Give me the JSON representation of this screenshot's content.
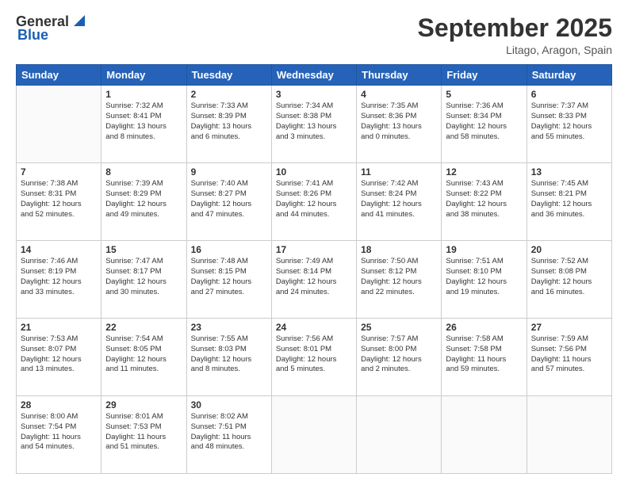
{
  "header": {
    "logo_general": "General",
    "logo_blue": "Blue",
    "month_title": "September 2025",
    "location": "Litago, Aragon, Spain"
  },
  "weekdays": [
    "Sunday",
    "Monday",
    "Tuesday",
    "Wednesday",
    "Thursday",
    "Friday",
    "Saturday"
  ],
  "weeks": [
    [
      {
        "day": "",
        "info": ""
      },
      {
        "day": "1",
        "info": "Sunrise: 7:32 AM\nSunset: 8:41 PM\nDaylight: 13 hours\nand 8 minutes."
      },
      {
        "day": "2",
        "info": "Sunrise: 7:33 AM\nSunset: 8:39 PM\nDaylight: 13 hours\nand 6 minutes."
      },
      {
        "day": "3",
        "info": "Sunrise: 7:34 AM\nSunset: 8:38 PM\nDaylight: 13 hours\nand 3 minutes."
      },
      {
        "day": "4",
        "info": "Sunrise: 7:35 AM\nSunset: 8:36 PM\nDaylight: 13 hours\nand 0 minutes."
      },
      {
        "day": "5",
        "info": "Sunrise: 7:36 AM\nSunset: 8:34 PM\nDaylight: 12 hours\nand 58 minutes."
      },
      {
        "day": "6",
        "info": "Sunrise: 7:37 AM\nSunset: 8:33 PM\nDaylight: 12 hours\nand 55 minutes."
      }
    ],
    [
      {
        "day": "7",
        "info": "Sunrise: 7:38 AM\nSunset: 8:31 PM\nDaylight: 12 hours\nand 52 minutes."
      },
      {
        "day": "8",
        "info": "Sunrise: 7:39 AM\nSunset: 8:29 PM\nDaylight: 12 hours\nand 49 minutes."
      },
      {
        "day": "9",
        "info": "Sunrise: 7:40 AM\nSunset: 8:27 PM\nDaylight: 12 hours\nand 47 minutes."
      },
      {
        "day": "10",
        "info": "Sunrise: 7:41 AM\nSunset: 8:26 PM\nDaylight: 12 hours\nand 44 minutes."
      },
      {
        "day": "11",
        "info": "Sunrise: 7:42 AM\nSunset: 8:24 PM\nDaylight: 12 hours\nand 41 minutes."
      },
      {
        "day": "12",
        "info": "Sunrise: 7:43 AM\nSunset: 8:22 PM\nDaylight: 12 hours\nand 38 minutes."
      },
      {
        "day": "13",
        "info": "Sunrise: 7:45 AM\nSunset: 8:21 PM\nDaylight: 12 hours\nand 36 minutes."
      }
    ],
    [
      {
        "day": "14",
        "info": "Sunrise: 7:46 AM\nSunset: 8:19 PM\nDaylight: 12 hours\nand 33 minutes."
      },
      {
        "day": "15",
        "info": "Sunrise: 7:47 AM\nSunset: 8:17 PM\nDaylight: 12 hours\nand 30 minutes."
      },
      {
        "day": "16",
        "info": "Sunrise: 7:48 AM\nSunset: 8:15 PM\nDaylight: 12 hours\nand 27 minutes."
      },
      {
        "day": "17",
        "info": "Sunrise: 7:49 AM\nSunset: 8:14 PM\nDaylight: 12 hours\nand 24 minutes."
      },
      {
        "day": "18",
        "info": "Sunrise: 7:50 AM\nSunset: 8:12 PM\nDaylight: 12 hours\nand 22 minutes."
      },
      {
        "day": "19",
        "info": "Sunrise: 7:51 AM\nSunset: 8:10 PM\nDaylight: 12 hours\nand 19 minutes."
      },
      {
        "day": "20",
        "info": "Sunrise: 7:52 AM\nSunset: 8:08 PM\nDaylight: 12 hours\nand 16 minutes."
      }
    ],
    [
      {
        "day": "21",
        "info": "Sunrise: 7:53 AM\nSunset: 8:07 PM\nDaylight: 12 hours\nand 13 minutes."
      },
      {
        "day": "22",
        "info": "Sunrise: 7:54 AM\nSunset: 8:05 PM\nDaylight: 12 hours\nand 11 minutes."
      },
      {
        "day": "23",
        "info": "Sunrise: 7:55 AM\nSunset: 8:03 PM\nDaylight: 12 hours\nand 8 minutes."
      },
      {
        "day": "24",
        "info": "Sunrise: 7:56 AM\nSunset: 8:01 PM\nDaylight: 12 hours\nand 5 minutes."
      },
      {
        "day": "25",
        "info": "Sunrise: 7:57 AM\nSunset: 8:00 PM\nDaylight: 12 hours\nand 2 minutes."
      },
      {
        "day": "26",
        "info": "Sunrise: 7:58 AM\nSunset: 7:58 PM\nDaylight: 11 hours\nand 59 minutes."
      },
      {
        "day": "27",
        "info": "Sunrise: 7:59 AM\nSunset: 7:56 PM\nDaylight: 11 hours\nand 57 minutes."
      }
    ],
    [
      {
        "day": "28",
        "info": "Sunrise: 8:00 AM\nSunset: 7:54 PM\nDaylight: 11 hours\nand 54 minutes."
      },
      {
        "day": "29",
        "info": "Sunrise: 8:01 AM\nSunset: 7:53 PM\nDaylight: 11 hours\nand 51 minutes."
      },
      {
        "day": "30",
        "info": "Sunrise: 8:02 AM\nSunset: 7:51 PM\nDaylight: 11 hours\nand 48 minutes."
      },
      {
        "day": "",
        "info": ""
      },
      {
        "day": "",
        "info": ""
      },
      {
        "day": "",
        "info": ""
      },
      {
        "day": "",
        "info": ""
      }
    ]
  ]
}
